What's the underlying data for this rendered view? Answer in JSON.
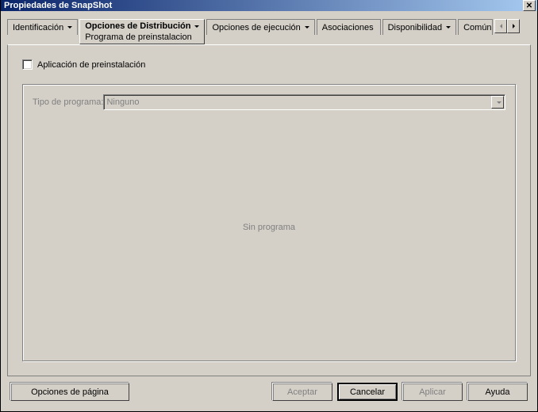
{
  "window": {
    "title": "Propiedades de SnapShot"
  },
  "tabs": {
    "identificacion": "Identificación",
    "opciones_distribucion": "Opciones de Distribución",
    "subtab": "Programa de preinstalacion",
    "opciones_ejecucion": "Opciones de ejecución",
    "asociaciones": "Asociaciones",
    "disponibilidad": "Disponibilidad",
    "comun": "Común"
  },
  "panel": {
    "checkbox_label": "Aplicación de preinstalación",
    "program_type_label": "Tipo de programa:",
    "program_type_value": "Ninguno",
    "no_program": "Sin programa"
  },
  "buttons": {
    "page_options": "Opciones de página",
    "accept": "Aceptar",
    "cancel": "Cancelar",
    "apply": "Aplicar",
    "help": "Ayuda"
  }
}
